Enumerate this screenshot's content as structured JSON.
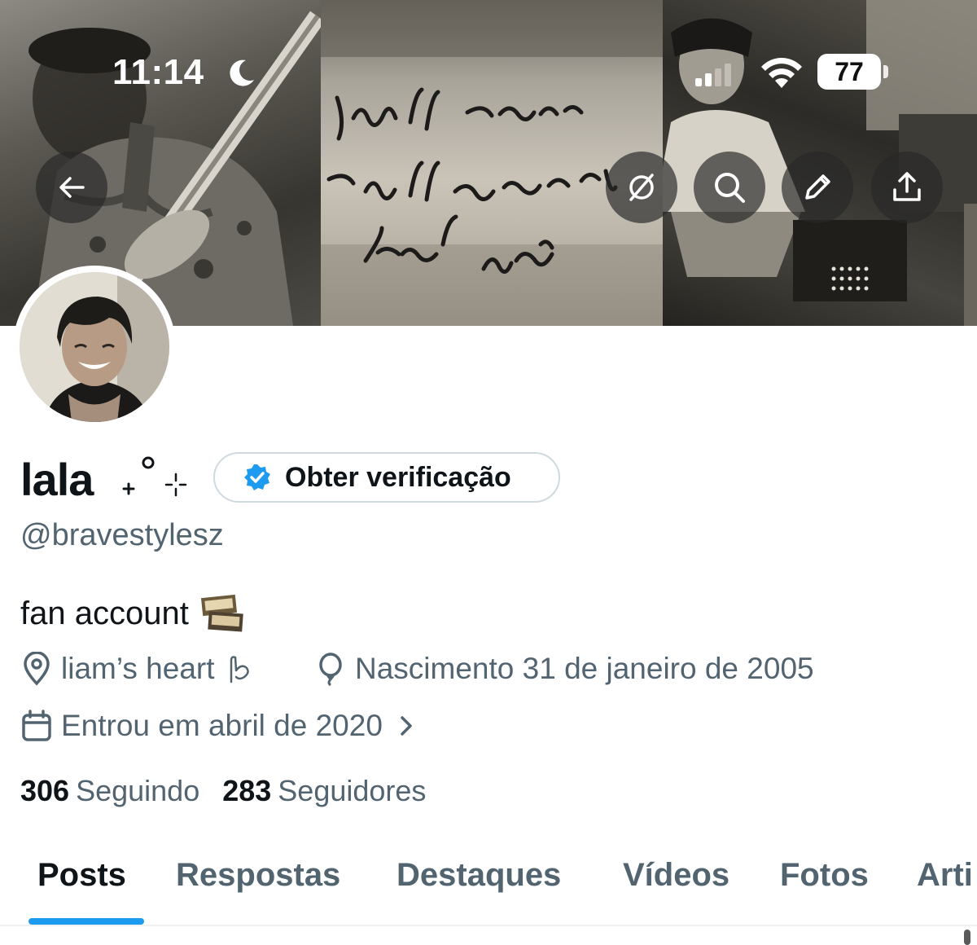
{
  "status_bar": {
    "time": "11:14",
    "battery": "77"
  },
  "header": {
    "banner_text_lines": [
      "I will come",
      "I will come and",
      "find you"
    ],
    "buttons": [
      "back-icon",
      "translate-icon",
      "search-icon",
      "edit-icon",
      "share-icon"
    ]
  },
  "profile": {
    "name": "lala",
    "decoration": "₊˚⊹",
    "verify_label": "Obter verificação",
    "handle": "@bravestylesz",
    "bio": "fan account",
    "bio_emoji": "film-frames-icon",
    "location": "liam’s heart",
    "location_emoji": "hand-heart-icon",
    "birthday": "Nascimento 31 de janeiro de 2005",
    "joined": "Entrou em abril de 2020",
    "following_count": "306",
    "following_label": "Seguindo",
    "followers_count": "283",
    "followers_label": "Seguidores"
  },
  "tabs": {
    "items": [
      "Posts",
      "Respostas",
      "Destaques",
      "Vídeos",
      "Fotos",
      "Arti"
    ],
    "active": "Posts"
  },
  "colors": {
    "accent": "#1d9bf0",
    "secondary_text": "#536471",
    "primary_text": "#0f1419",
    "border": "#cfd9de"
  }
}
